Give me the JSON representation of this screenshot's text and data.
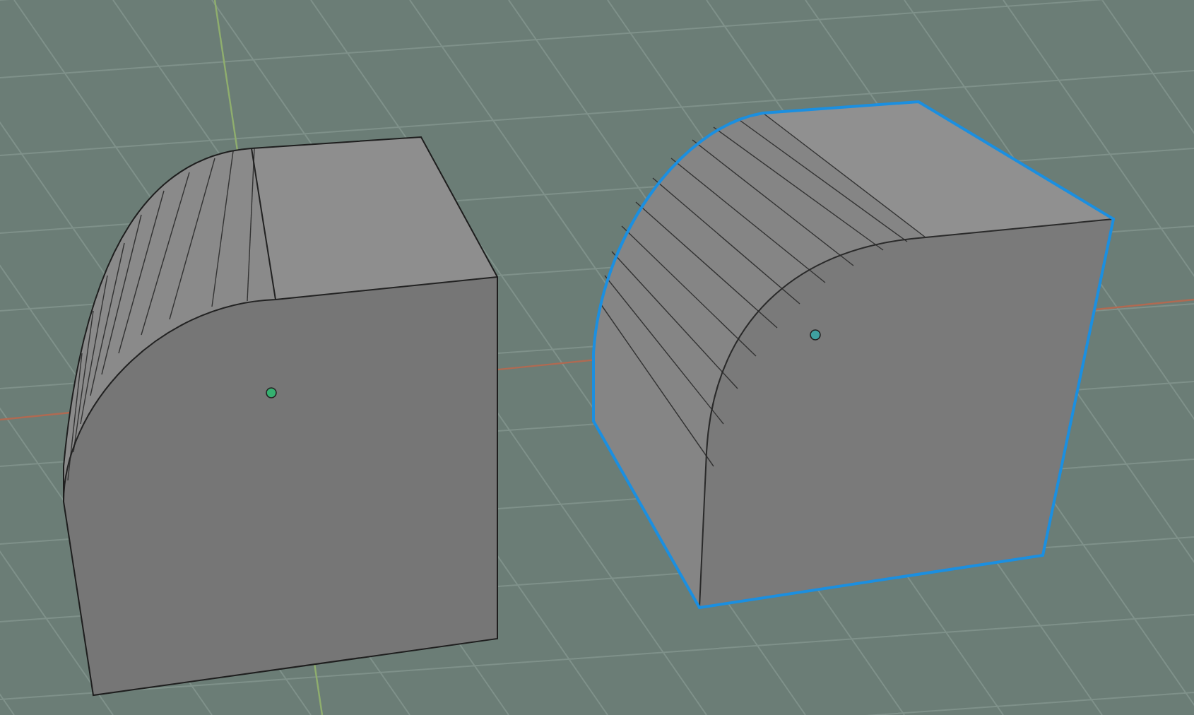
{
  "viewport": {
    "objects": [
      {
        "selected": false
      },
      {
        "selected": true
      }
    ]
  }
}
